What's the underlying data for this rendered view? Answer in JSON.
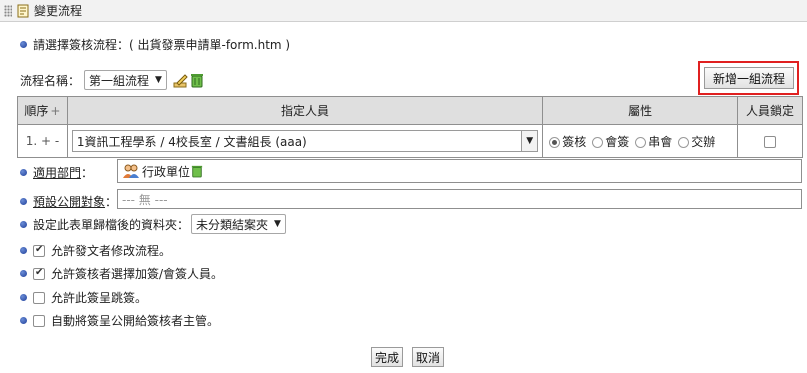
{
  "window": {
    "title": "變更流程"
  },
  "select_flow_text": "請選擇簽核流程：( 出貨發票申請單-form.htm )",
  "flow_name": {
    "label": "流程名稱：",
    "value": "第一組流程"
  },
  "add_flow_button": "新增一組流程",
  "table": {
    "headers": {
      "order": "順序",
      "add": "+",
      "assignee": "指定人員",
      "attribute": "屬性",
      "lock": "人員鎖定"
    },
    "rows": [
      {
        "order": "1.",
        "plus": "+",
        "minus": "-",
        "assignee": "1資訊工程學系 / 4校長室 / 文書組長 (aaa)",
        "options": [
          "簽核",
          "會簽",
          "串會",
          "交辦"
        ],
        "selected": "簽核",
        "locked": false
      }
    ]
  },
  "department": {
    "label": "適用部門",
    "colon": "：",
    "value": "行政單位"
  },
  "public_target": {
    "label": "預設公開對象",
    "colon": "：",
    "value": "--- 無 ---"
  },
  "archive_folder": {
    "label": "設定此表單歸檔後的資料夾：",
    "value": "未分類結案夾"
  },
  "checkboxes": [
    {
      "label": "允許發文者修改流程。",
      "checked": true
    },
    {
      "label": "允許簽核者選擇加簽/會簽人員。",
      "checked": true
    },
    {
      "label": "允許此簽呈跳簽。",
      "checked": false
    },
    {
      "label": "自動將簽呈公開給簽核者主管。",
      "checked": false
    }
  ],
  "buttons": {
    "done": "完成",
    "cancel": "取消"
  }
}
